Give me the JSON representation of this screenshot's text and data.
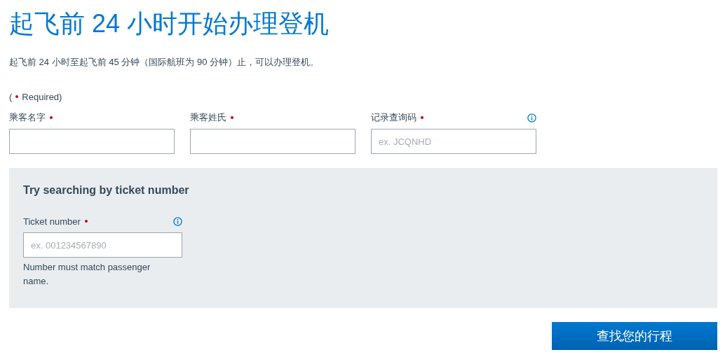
{
  "title": "起飞前 24 小时开始办理登机",
  "intro": "起飞前 24 小时至起飞前 45 分钟（国际航班为 90 分钟）止，可以办理登机。",
  "required_note": {
    "open": "(",
    "text": "Required)"
  },
  "fields": [
    {
      "label": "乘客名字",
      "required": true,
      "info": false
    },
    {
      "label": "乘客姓氏",
      "required": true,
      "info": false
    },
    {
      "label": "记录查询码",
      "required": true,
      "info": true,
      "placeholder": "ex. JCQNHD"
    }
  ],
  "ticket_panel": {
    "heading": "Try searching by ticket number",
    "field": {
      "label": "Ticket number",
      "required": true,
      "info": true,
      "placeholder": "ex. 001234567890"
    },
    "hint": "Number must match passenger name."
  },
  "button": "查找您的行程"
}
